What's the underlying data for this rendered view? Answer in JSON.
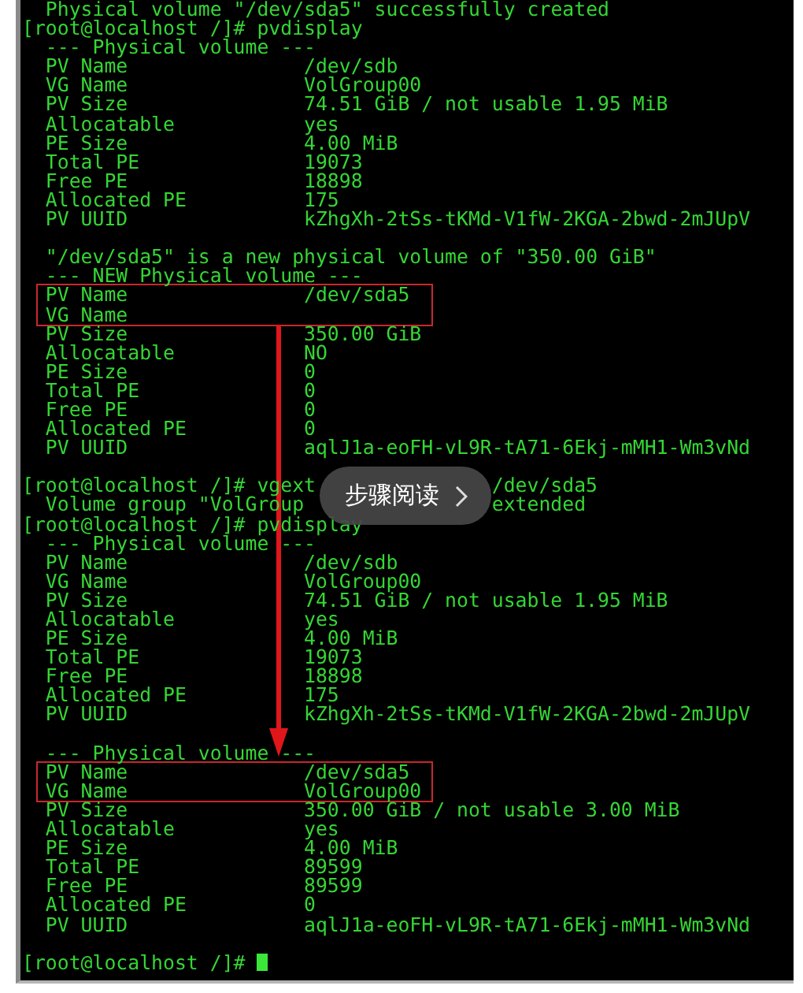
{
  "terminal": {
    "lines": [
      {
        "kind": "text",
        "text": "  Physical volume \"/dev/sda5\" successfully created"
      },
      {
        "kind": "text",
        "text": "[root@localhost /]# pvdisplay"
      },
      {
        "kind": "text",
        "text": "  --- Physical volume ---"
      },
      {
        "kind": "field",
        "label": "PV Name",
        "value": "/dev/sdb"
      },
      {
        "kind": "field",
        "label": "VG Name",
        "value": "VolGroup00"
      },
      {
        "kind": "field",
        "label": "PV Size",
        "value": "74.51 GiB / not usable 1.95 MiB"
      },
      {
        "kind": "field",
        "label": "Allocatable",
        "value": "yes"
      },
      {
        "kind": "field",
        "label": "PE Size",
        "value": "4.00 MiB"
      },
      {
        "kind": "field",
        "label": "Total PE",
        "value": "19073"
      },
      {
        "kind": "field",
        "label": "Free PE",
        "value": "18898"
      },
      {
        "kind": "field",
        "label": "Allocated PE",
        "value": "175"
      },
      {
        "kind": "field",
        "label": "PV UUID",
        "value": "kZhgXh-2tSs-tKMd-V1fW-2KGA-2bwd-2mJUpV"
      },
      {
        "kind": "blank"
      },
      {
        "kind": "text",
        "text": "  \"/dev/sda5\" is a new physical volume of \"350.00 GiB\""
      },
      {
        "kind": "text",
        "text": "  --- NEW Physical volume ---"
      },
      {
        "kind": "boxed",
        "fields": [
          {
            "label": "PV Name",
            "value": "/dev/sda5"
          },
          {
            "label": "VG Name"
          }
        ]
      },
      {
        "kind": "field",
        "label": "PV Size",
        "value": "350.00 GiB"
      },
      {
        "kind": "field",
        "label": "Allocatable",
        "value": "NO"
      },
      {
        "kind": "field",
        "label": "PE Size",
        "value": "0"
      },
      {
        "kind": "field",
        "label": "Total PE",
        "value": "0"
      },
      {
        "kind": "field",
        "label": "Free PE",
        "value": "0"
      },
      {
        "kind": "field",
        "label": "Allocated PE",
        "value": "0"
      },
      {
        "kind": "field",
        "label": "PV UUID",
        "value": "aqlJ1a-eoFH-vL9R-tA71-6Ekj-mMH1-Wm3vNd"
      },
      {
        "kind": "blank"
      },
      {
        "kind": "overlaid",
        "rows": [
          {
            "left": "[root@localhost /]# vgext",
            "right": "/dev/sda5"
          },
          {
            "left": "  Volume group \"VolGroup",
            "right": "extended"
          }
        ],
        "overlay": {
          "label": "步骤阅读"
        }
      },
      {
        "kind": "text",
        "text": "[root@localhost /]# pvdisplay"
      },
      {
        "kind": "text",
        "text": "  --- Physical volume ---"
      },
      {
        "kind": "field",
        "label": "PV Name",
        "value": "/dev/sdb"
      },
      {
        "kind": "field",
        "label": "VG Name",
        "value": "VolGroup00"
      },
      {
        "kind": "field",
        "label": "PV Size",
        "value": "74.51 GiB / not usable 1.95 MiB"
      },
      {
        "kind": "field",
        "label": "Allocatable",
        "value": "yes"
      },
      {
        "kind": "field",
        "label": "PE Size",
        "value": "4.00 MiB"
      },
      {
        "kind": "field",
        "label": "Total PE",
        "value": "19073"
      },
      {
        "kind": "field",
        "label": "Free PE",
        "value": "18898"
      },
      {
        "kind": "field",
        "label": "Allocated PE",
        "value": "175"
      },
      {
        "kind": "field",
        "label": "PV UUID",
        "value": "kZhgXh-2tSs-tKMd-V1fW-2KGA-2bwd-2mJUpV"
      },
      {
        "kind": "blank"
      },
      {
        "kind": "text",
        "text": "  --- Physical volume ---"
      },
      {
        "kind": "boxed",
        "fields": [
          {
            "label": "PV Name",
            "value": "/dev/sda5"
          },
          {
            "label": "VG Name",
            "value": "VolGroup00"
          }
        ]
      },
      {
        "kind": "field",
        "label": "PV Size",
        "value": "350.00 GiB / not usable 3.00 MiB"
      },
      {
        "kind": "field",
        "label": "Allocatable",
        "value": "yes"
      },
      {
        "kind": "field",
        "label": "PE Size",
        "value": "4.00 MiB"
      },
      {
        "kind": "field",
        "label": "Total PE",
        "value": "89599"
      },
      {
        "kind": "field",
        "label": "Free PE",
        "value": "89599"
      },
      {
        "kind": "field",
        "label": "Allocated PE",
        "value": "0"
      },
      {
        "kind": "field",
        "label": "PV UUID",
        "value": "aqlJ1a-eoFH-vL9R-tA71-6Ekj-mMH1-Wm3vNd"
      },
      {
        "kind": "blank"
      },
      {
        "kind": "prompt",
        "text": "[root@localhost /]#",
        "cursor": true
      }
    ]
  }
}
